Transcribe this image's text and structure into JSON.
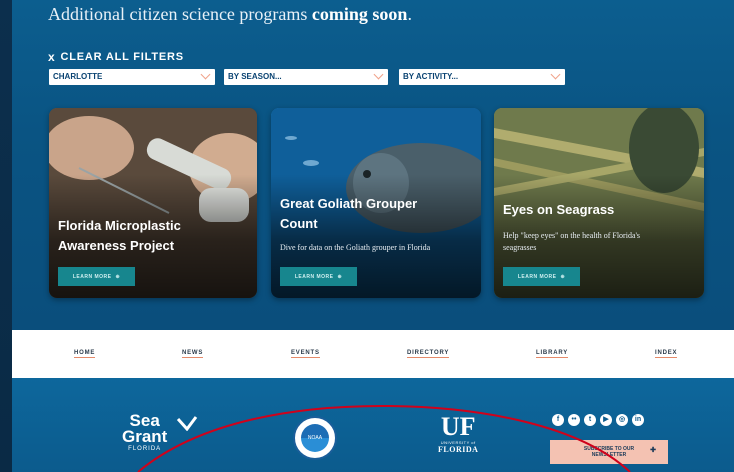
{
  "header": {
    "coming_soon_prefix": "Additional citizen science programs",
    "coming_soon_bold": "coming soon",
    "coming_soon_suffix": "."
  },
  "filters": {
    "clear_icon": "x",
    "clear_label": "CLEAR ALL FILTERS",
    "county": "CHARLOTTE",
    "season": "BY SEASON...",
    "activity": "BY ACTIVITY..."
  },
  "cards": [
    {
      "title_line1": "Florida Microplastic",
      "title_line2": "Awareness Project",
      "description": "",
      "button": "LEARN MORE",
      "button_icon": "⊕"
    },
    {
      "title_line1": "Great Goliath Grouper",
      "title_line2": "Count",
      "description": "Dive for data on the Goliath grouper in Florida",
      "button": "LEARN MORE",
      "button_icon": "⊕"
    },
    {
      "title_line1": "Eyes on Seagrass",
      "title_line2": "",
      "description_line1": "Help \"keep eyes\" on the health of Florida's",
      "description_line2": "seagrasses",
      "button": "LEARN MORE",
      "button_icon": "⊕"
    }
  ],
  "nav": [
    "HOME",
    "NEWS",
    "EVENTS",
    "DIRECTORY",
    "LIBRARY",
    "INDEX"
  ],
  "footer": {
    "seagrant_line1": "Sea",
    "seagrant_line2": "Grant",
    "seagrant_sub": "FLORIDA",
    "noaa_label": "NOAA",
    "uf_mark": "UF",
    "uf_university": "UNIVERSITY of",
    "uf_florida": "FLORIDA",
    "social_icons": [
      "facebook-icon",
      "flickr-icon",
      "twitter-icon",
      "youtube-icon",
      "instagram-icon",
      "linkedin-icon"
    ],
    "subscribe_line1": "SUBSCRIBE TO OUR",
    "subscribe_line2": "NEWSLETTER"
  },
  "colors": {
    "hero": "#0a5483",
    "learn_button": "#17868e",
    "subscribe_button": "#f4c2b2",
    "annotation": "#d0021b"
  }
}
